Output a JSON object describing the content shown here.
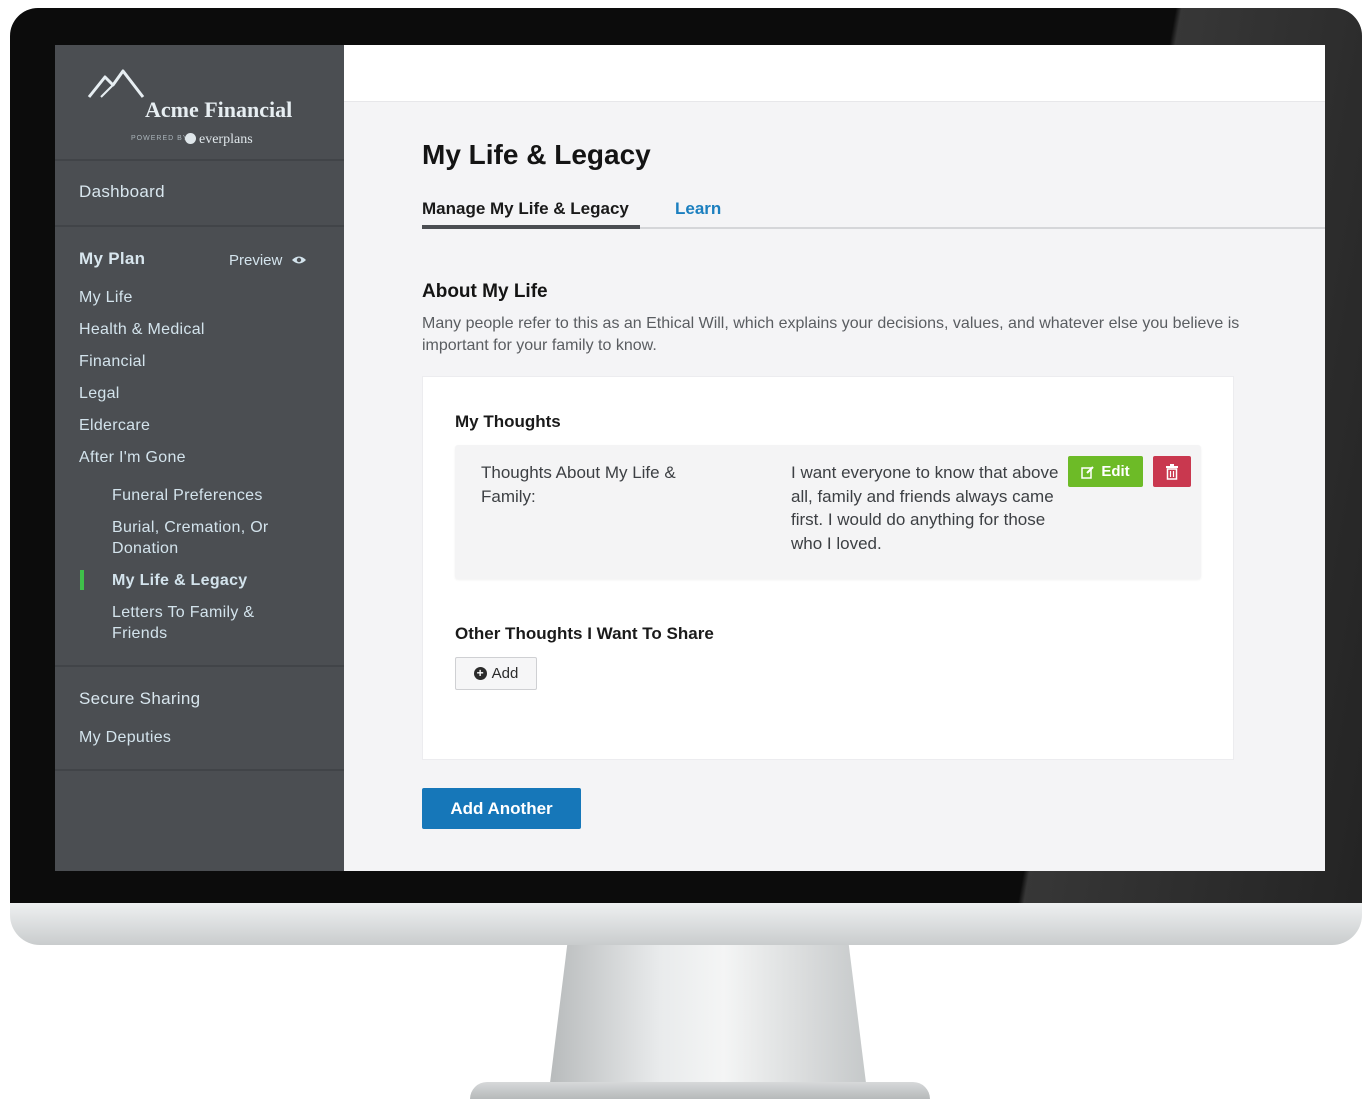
{
  "brand": {
    "name": "Acme Financial",
    "powered_by": "POWERED BY",
    "partner": "everplans"
  },
  "sidebar": {
    "dashboard": "Dashboard",
    "my_plan": "My Plan",
    "preview": "Preview",
    "items": [
      "My Life",
      "Health & Medical",
      "Financial",
      "Legal",
      "Eldercare",
      "After I'm Gone"
    ],
    "sub_items": [
      "Funeral Preferences",
      "Burial, Cremation, Or Donation",
      "My Life & Legacy",
      "Letters To Family & Friends"
    ],
    "secure_sharing": "Secure Sharing",
    "my_deputies": "My Deputies",
    "active_color": "#3fbf4a"
  },
  "main": {
    "title": "My Life & Legacy",
    "tabs": [
      {
        "label": "Manage My Life & Legacy",
        "active": true
      },
      {
        "label": "Learn",
        "active": false
      }
    ],
    "section": {
      "title": "About My Life",
      "description": "Many people refer to this as an Ethical Will, which explains your decisions, values, and whatever else you believe is important for your family to know."
    },
    "card": {
      "my_thoughts_title": "My Thoughts",
      "entry": {
        "label": "Thoughts About My Life & Family:",
        "value": "I want everyone to know that above all, family and friends always came first. I would do anything for those who I loved."
      },
      "edit_label": "Edit",
      "other_title": "Other Thoughts I Want To Share",
      "add_label": "Add"
    },
    "add_another_label": "Add Another"
  },
  "colors": {
    "sidebar_bg": "#4b4e52",
    "link": "#1b7fbf",
    "edit": "#6dbb27",
    "delete": "#c9384f",
    "primary": "#1677b9"
  }
}
